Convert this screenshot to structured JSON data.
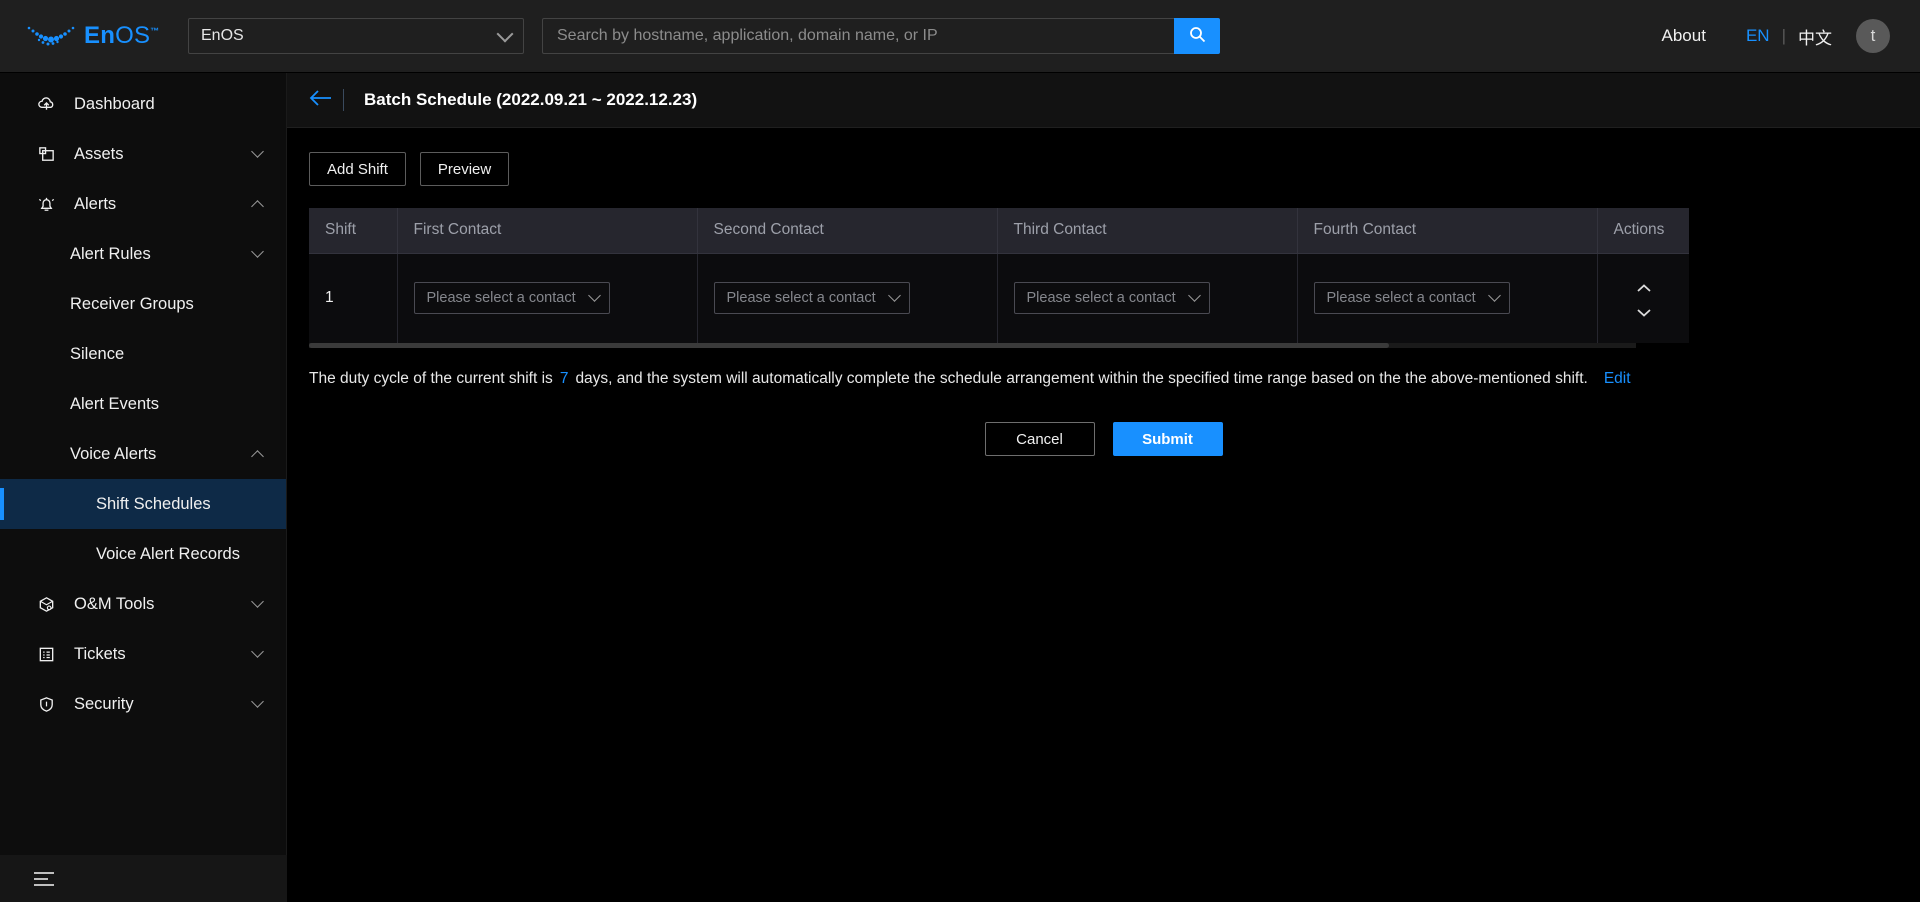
{
  "topbar": {
    "brand": {
      "en": "En",
      "os": "OS",
      "tm": "™",
      "logo_icon": "enos-swoosh-logo"
    },
    "app_select": {
      "value": "EnOS",
      "icon": "chevron-down-icon"
    },
    "search": {
      "placeholder": "Search by hostname, application, domain name, or IP",
      "value": "",
      "button_icon": "search-icon"
    },
    "about_label": "About",
    "lang_en": "EN",
    "lang_divider": "|",
    "lang_cn": "中文",
    "avatar_initial": "t"
  },
  "sidebar": {
    "items": [
      {
        "label": "Dashboard",
        "icon": "cloud-dashboard-icon",
        "level": 0,
        "expander": "",
        "active": false
      },
      {
        "label": "Assets",
        "icon": "assets-box-icon",
        "level": 0,
        "expander": "down",
        "active": false
      },
      {
        "label": "Alerts",
        "icon": "alert-bell-icon",
        "level": 0,
        "expander": "up",
        "active": false
      },
      {
        "label": "Alert Rules",
        "icon": "",
        "level": 1,
        "expander": "down",
        "active": false
      },
      {
        "label": "Receiver Groups",
        "icon": "",
        "level": 1,
        "expander": "",
        "active": false
      },
      {
        "label": "Silence",
        "icon": "",
        "level": 1,
        "expander": "",
        "active": false
      },
      {
        "label": "Alert Events",
        "icon": "",
        "level": 1,
        "expander": "",
        "active": false
      },
      {
        "label": "Voice Alerts",
        "icon": "",
        "level": 1,
        "expander": "up",
        "active": false
      },
      {
        "label": "Shift Schedules",
        "icon": "",
        "level": 2,
        "expander": "",
        "active": true
      },
      {
        "label": "Voice Alert Records",
        "icon": "",
        "level": 2,
        "expander": "",
        "active": false
      },
      {
        "label": "O&M Tools",
        "icon": "om-tools-cube-icon",
        "level": 0,
        "expander": "down",
        "active": false
      },
      {
        "label": "Tickets",
        "icon": "tickets-list-icon",
        "level": 0,
        "expander": "down",
        "active": false
      },
      {
        "label": "Security",
        "icon": "security-shield-icon",
        "level": 0,
        "expander": "down",
        "active": false
      }
    ],
    "collapse_icon": "hamburger-icon"
  },
  "page": {
    "back_icon": "arrow-left-icon",
    "title": "Batch Schedule (2022.09.21 ~ 2022.12.23)",
    "toolbar": {
      "add_shift_label": "Add Shift",
      "preview_label": "Preview"
    },
    "table": {
      "columns": [
        "Shift",
        "First Contact",
        "Second Contact",
        "Third Contact",
        "Fourth Contact",
        "Actions"
      ],
      "rows": [
        {
          "shift": "1",
          "first_contact": "Please select a contact",
          "second_contact": "Please select a contact",
          "third_contact": "Please select a contact",
          "fourth_contact": "Please select a contact",
          "move_up_icon": "chevron-up-icon",
          "move_down_icon": "chevron-down-icon"
        }
      ]
    },
    "note": {
      "prefix": "The duty cycle of the current shift is",
      "days": "7",
      "suffix": "days, and the system will automatically complete the schedule arrangement within the specified time range based on the the above-mentioned shift.",
      "edit_label": "Edit"
    },
    "footer": {
      "cancel_label": "Cancel",
      "submit_label": "Submit"
    }
  },
  "colors": {
    "accent": "#1890ff",
    "page_bg": "#000000",
    "topbar_bg": "#1f1f1f",
    "sidebar_bg": "#0d0d0d",
    "table_header_bg": "#26262e",
    "active_item_bg": "#0e2a47"
  }
}
